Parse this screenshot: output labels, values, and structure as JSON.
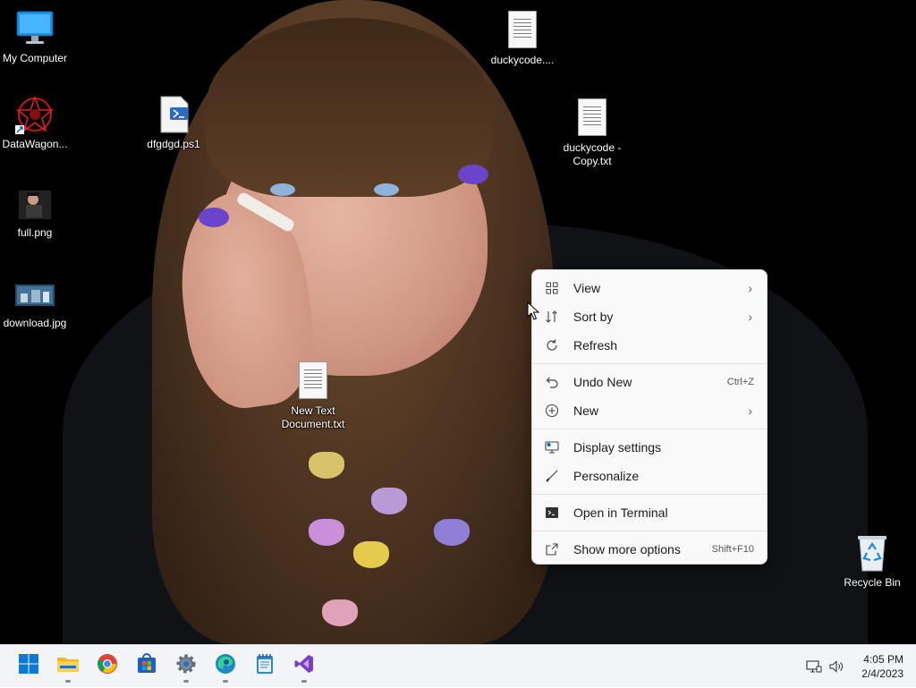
{
  "desktop": {
    "icons": [
      {
        "label": "My Computer",
        "type": "computer"
      },
      {
        "label": "DataWagon...",
        "type": "shortcut-art"
      },
      {
        "label": "full.png",
        "type": "image"
      },
      {
        "label": "download.jpg",
        "type": "image"
      },
      {
        "label": "dfgdgd.ps1",
        "type": "powershell"
      },
      {
        "label": "duckycode....",
        "type": "text"
      },
      {
        "label": "duckycode -\nCopy.txt",
        "type": "text"
      },
      {
        "label": "New Text\nDocument.txt",
        "type": "text"
      },
      {
        "label": "Recycle Bin",
        "type": "recycle-bin"
      }
    ]
  },
  "context_menu": {
    "items": [
      {
        "label": "View",
        "icon": "grid-icon",
        "submenu": true
      },
      {
        "label": "Sort by",
        "icon": "sort-icon",
        "submenu": true
      },
      {
        "label": "Refresh",
        "icon": "refresh-icon"
      },
      {
        "label": "Undo New",
        "icon": "undo-icon",
        "shortcut": "Ctrl+Z"
      },
      {
        "label": "New",
        "icon": "plus-circle-icon",
        "submenu": true
      },
      {
        "label": "Display settings",
        "icon": "display-icon"
      },
      {
        "label": "Personalize",
        "icon": "brush-icon"
      },
      {
        "label": "Open in Terminal",
        "icon": "terminal-icon"
      },
      {
        "label": "Show more options",
        "icon": "share-icon",
        "shortcut": "Shift+F10"
      }
    ],
    "submenu_glyph": "›"
  },
  "taskbar": {
    "apps": [
      "start",
      "file-explorer",
      "chrome",
      "microsoft-store",
      "settings",
      "edge",
      "notepad",
      "visual-studio"
    ],
    "clock": {
      "time": "4:05 PM",
      "date": "2/4/2023"
    }
  },
  "colors": {
    "accent": "#0067c0",
    "taskbar": "#f2f4f8",
    "menu": "#f9f9f9"
  }
}
